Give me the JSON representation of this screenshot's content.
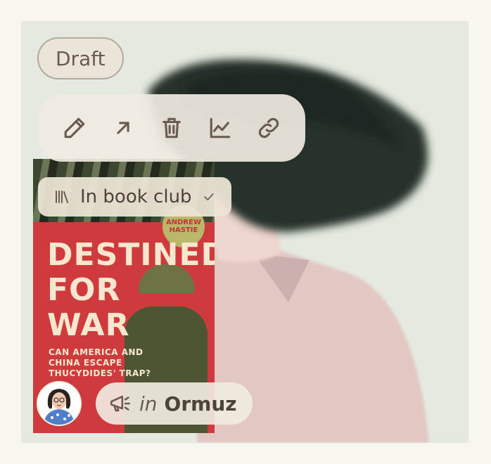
{
  "status_badge": "Draft",
  "toolbar": {
    "edit_icon": "pencil-icon",
    "open_icon": "arrow-up-right-icon",
    "delete_icon": "trash-icon",
    "stats_icon": "chart-icon",
    "link_icon": "link-icon"
  },
  "book": {
    "title_lines": [
      "DESTINED",
      "FOR",
      "WAR"
    ],
    "subtitle_lines": [
      "CAN AMERICA AND",
      "CHINA ESCAPE",
      "THUCYDIDES' TRAP?"
    ],
    "badge": "ANDREW HASTIE"
  },
  "book_club": {
    "label": "In book club",
    "icon": "books-icon",
    "check_icon": "check-icon"
  },
  "footer": {
    "in_label": "in",
    "place": "Ormuz",
    "megaphone_icon": "megaphone-icon"
  },
  "colors": {
    "background": "#f9f6f0",
    "pill": "#ece4d8",
    "text": "#5a4c43",
    "book_red": "#cf3b3d"
  }
}
